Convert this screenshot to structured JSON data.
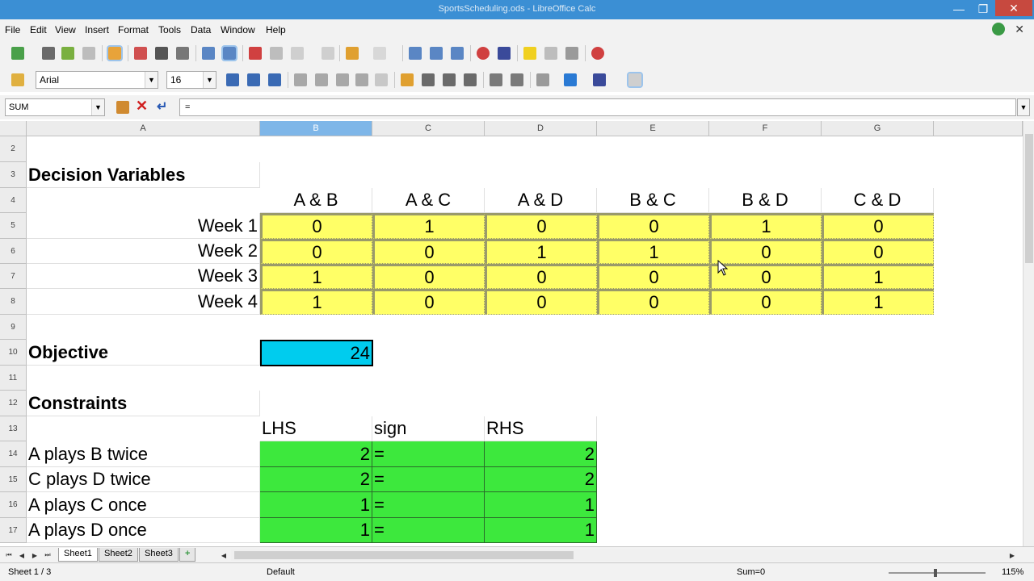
{
  "window": {
    "title": "SportsScheduling.ods - LibreOffice Calc",
    "minimize": "—",
    "restore": "❐",
    "close": "✕"
  },
  "menu": [
    "File",
    "Edit",
    "View",
    "Insert",
    "Format",
    "Tools",
    "Data",
    "Window",
    "Help"
  ],
  "format_toolbar": {
    "font_name": "Arial",
    "font_size": "16"
  },
  "formula_bar": {
    "name_box": "SUM",
    "formula": "="
  },
  "columns": [
    "A",
    "B",
    "C",
    "D",
    "E",
    "F",
    "G"
  ],
  "selected_column": "B",
  "rows": [
    "2",
    "3",
    "4",
    "5",
    "6",
    "7",
    "8",
    "9",
    "10",
    "11",
    "12",
    "13",
    "14",
    "15",
    "16",
    "17"
  ],
  "sheet": {
    "decision_title": "Decision Variables",
    "matchups": [
      "A & B",
      "A & C",
      "A & D",
      "B & C",
      "B & D",
      "C & D"
    ],
    "weeks": [
      {
        "label": "Week 1",
        "values": [
          "0",
          "1",
          "0",
          "0",
          "1",
          "0"
        ]
      },
      {
        "label": "Week 2",
        "values": [
          "0",
          "0",
          "1",
          "1",
          "0",
          "0"
        ]
      },
      {
        "label": "Week 3",
        "values": [
          "1",
          "0",
          "0",
          "0",
          "0",
          "1"
        ]
      },
      {
        "label": "Week 4",
        "values": [
          "1",
          "0",
          "0",
          "0",
          "0",
          "1"
        ]
      }
    ],
    "objective_label": "Objective",
    "objective_value": "24",
    "constraints_title": "Constraints",
    "constraint_headers": [
      "LHS",
      "sign",
      "RHS"
    ],
    "constraints": [
      {
        "label": "A plays B twice",
        "lhs": "2",
        "sign": "=",
        "rhs": "2"
      },
      {
        "label": "C plays D twice",
        "lhs": "2",
        "sign": "=",
        "rhs": "2"
      },
      {
        "label": "A plays C once",
        "lhs": "1",
        "sign": "=",
        "rhs": "1"
      },
      {
        "label": "A plays D once",
        "lhs": "1",
        "sign": "=",
        "rhs": "1"
      }
    ]
  },
  "sheet_tabs": [
    "Sheet1",
    "Sheet2",
    "Sheet3"
  ],
  "active_tab": "Sheet1",
  "status": {
    "sheet_info": "Sheet 1 / 3",
    "page_style": "Default",
    "sum": "Sum=0",
    "zoom": "115%"
  },
  "colors": {
    "decision_fill": "#ffff66",
    "objective_fill": "#00ccee",
    "constraint_fill": "#3de83d"
  }
}
